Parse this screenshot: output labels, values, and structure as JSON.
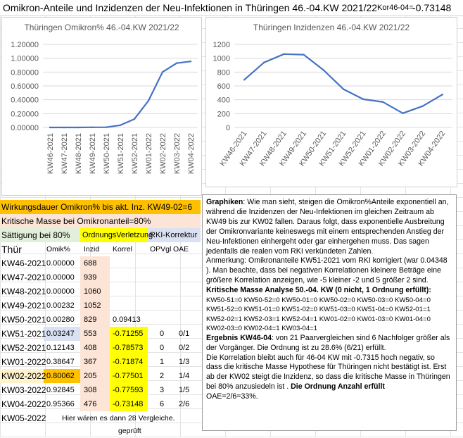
{
  "header": {
    "title": "Omikron-Anteile und Inzidenzen der Neu-Infektionen in Thüringen 46.-04.KW 2021/22",
    "kor_label": "Kor46-04=",
    "kor_value": "-0.73148"
  },
  "chart_data": [
    {
      "type": "line",
      "title": "Thüringen Omikron%  46.-04.KW 2021/22",
      "categories": [
        "KW46-2021",
        "KW47-2021",
        "KW48-2021",
        "KW49-2021",
        "KW50-2021",
        "KW51-2021",
        "KW52-2021",
        "KW01-2022",
        "KW02-2022",
        "KW03-2022",
        "KW04-2022"
      ],
      "series": [
        {
          "values": [
            0.0,
            0.0,
            0.0,
            0.00232,
            0.0028,
            0.03247,
            0.12143,
            0.38647,
            0.80062,
            0.92845,
            0.95366
          ]
        }
      ],
      "ylim": [
        0,
        1.2
      ],
      "yticks": [
        "0.00000",
        "0.20000",
        "0.40000",
        "0.60000",
        "0.80000",
        "1.00000",
        "1.20000"
      ],
      "grid": true,
      "color": "#4472c4"
    },
    {
      "type": "line",
      "title": "Thüringen Inzidenzen  46.-04.KW 2021/22",
      "categories": [
        "KW46-2021",
        "KW47-2021",
        "KW48-2021",
        "KW49-2021",
        "KW50-2021",
        "KW51-2021",
        "KW52-2021",
        "KW01-2022",
        "KW02-2022",
        "KW03-2022",
        "KW04-2022"
      ],
      "series": [
        {
          "values": [
            688,
            939,
            1060,
            1052,
            829,
            553,
            408,
            367,
            205,
            308,
            476
          ]
        }
      ],
      "ylim": [
        0,
        1200
      ],
      "yticks": [
        "0",
        "200",
        "400",
        "600",
        "800",
        "1000",
        "1200"
      ],
      "grid": true,
      "color": "#4472c4"
    }
  ],
  "left_panel": {
    "line1": "Wirkungsdauer Omikron% bis akt. Inz. KW49-02=6",
    "line2": "Kritische Masse bei Omikronanteil=80%",
    "line3_a": "Sättigung bei 80%",
    "line3_b": "OrdnungsVerletzung",
    "line3_c": "RKI-Korrektur",
    "headers": {
      "kw": "Thür",
      "omik": "Omik%",
      "inzid": "Inzid",
      "korrel": "Korrel",
      "opvgl": "OPVgl",
      "oae": "OAE"
    },
    "rows": [
      {
        "kw": "KW46-2021",
        "omik": "0.00000",
        "inzid": "688",
        "korrel": "",
        "opvgl": "",
        "oae": ""
      },
      {
        "kw": "KW47-2021",
        "omik": "0.00000",
        "inzid": "939",
        "korrel": "",
        "opvgl": "",
        "oae": ""
      },
      {
        "kw": "KW48-2021",
        "omik": "0.00000",
        "inzid": "1060",
        "korrel": "",
        "opvgl": "",
        "oae": ""
      },
      {
        "kw": "KW49-2021",
        "omik": "0.00232",
        "inzid": "1052",
        "korrel": "",
        "opvgl": "",
        "oae": ""
      },
      {
        "kw": "KW50-2021",
        "omik": "0.00280",
        "inzid": "829",
        "korrel": "0.09413",
        "opvgl": "",
        "oae": ""
      },
      {
        "kw": "KW51-2021",
        "omik": "0.03247",
        "inzid": "553",
        "korrel": "-0.71255",
        "opvgl": "0",
        "oae": "0/1"
      },
      {
        "kw": "KW52-2021",
        "omik": "0.12143",
        "inzid": "408",
        "korrel": "-0.78573",
        "opvgl": "0",
        "oae": "0/2"
      },
      {
        "kw": "KW01-2022",
        "omik": "0.38647",
        "inzid": "367",
        "korrel": "-0.71874",
        "opvgl": "1",
        "oae": "1/3"
      },
      {
        "kw": "KW02-2022",
        "omik": "0.80062",
        "inzid": "205",
        "korrel": "-0.77501",
        "opvgl": "2",
        "oae": "1/4"
      },
      {
        "kw": "KW03-2022",
        "omik": "0.92845",
        "inzid": "308",
        "korrel": "-0.77593",
        "opvgl": "3",
        "oae": "1/5"
      },
      {
        "kw": "KW04-2022",
        "omik": "0.95366",
        "inzid": "476",
        "korrel": "-0.73148",
        "opvgl": "6",
        "oae": "2/6"
      }
    ],
    "kw05": "KW05-2022",
    "kw05_note": "Hier wären es dann 28 Vergleiche.",
    "geprueft": "geprüft"
  },
  "notes": {
    "p1_bold": "Graphiken",
    "p1": ": Wie man sieht, steigen die Omikron%Anteile exponentiell an, während die Inzidenzen der Neu-Infektionen im gleichen Zeitraum ab KW49 bis zur KW02 fallen. Daraus folgt, dass exponentielle Ausbreitung der Omikronvariante keineswegs mit einem entsprechenden Anstieg der Neu-Infektionen einhergeht oder gar einhergehen muss. Das sagen jedenfalls die realen vom RKI verkündeten Zahlen.",
    "p2": "Anmerkung: Omikronanteile KW51-2021 vom RKI korrigiert (war 0.04348 ). Man beachte, dass bei negativen Korrelationen kleinere Beträge eine größere Korrelation anzeigen, wie -5 kleiner -2 und 5 größer 2 sind.",
    "p3": "Kritische Masse Analyse 50.-04. KW  (0 nicht, 1 Ordnung erfüllt):",
    "p4": "KW50-51=0  KW50-52=0  KW50-01=0  KW50-02=0  KW50-03=0  KW50-04=0  KW51-52=0  KW51-01=0  KW51-02=0  KW51-03=0  KW51-04=0  KW52-01=1  KW52-02=1  KW52-03=1  KW52-04=1  KW01-02=0  KW01-03=0  KW01-04=0  KW02-03=0  KW02-04=1  KW03-04=1",
    "p5_bold": "Ergebnis KW46-04",
    "p5": ": von 21 Paarvergleichen sind 6 Nachfolger größer als der Vorgänger. Die Ordnung ist zu 28.6% (6/21) erfüllt.",
    "p6": "Die Korrelation bleibt auch für 46-04 KW mit -0.7315 hoch negativ, so dass die kritische Masse Hypothese für Thüringen nicht bestätigt ist. Erst ab der KW02 steigt die Inzidenz, so dass die kritische Masse in Thüringen bei 80% anzusiedeln ist . ",
    "p6_bold": "Die Ordnung Anzahl erfüllt",
    "p7": "OAE=2/6=33%."
  }
}
